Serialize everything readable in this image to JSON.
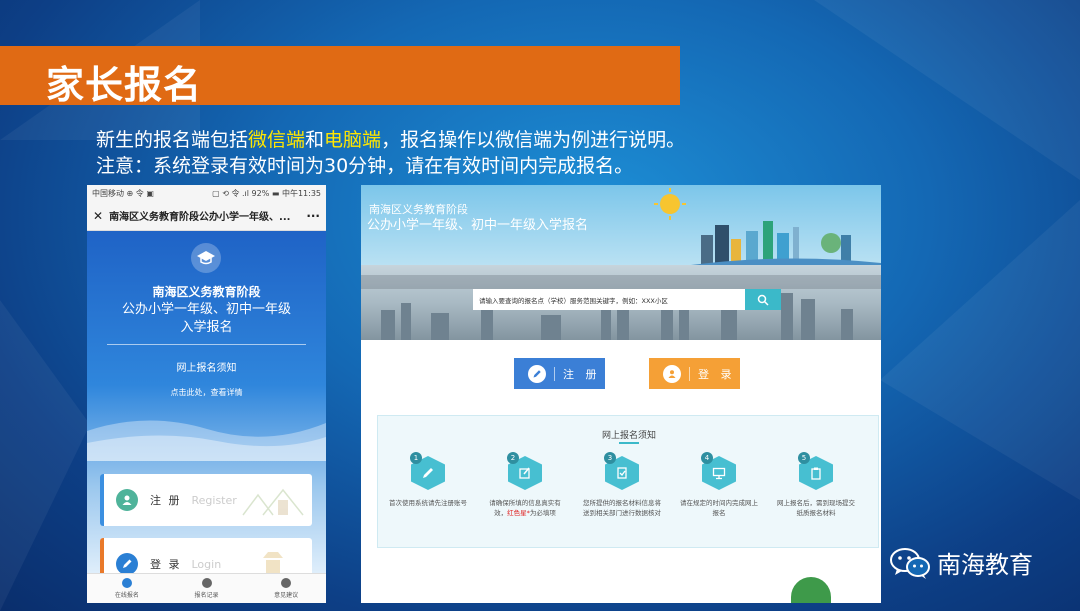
{
  "slide_title": "家长报名",
  "intro": {
    "line1_a": "新生的报名端包括",
    "line1_wechat": "微信端",
    "line1_and": "和",
    "line1_pc": "电脑端",
    "line1_b": "，报名操作以微信端为例进行说明。",
    "line2": "注意：系统登录有效时间为30分钟，请在有效时间内完成报名。"
  },
  "phone": {
    "status_left": "中国移动 ⊕ 令 ▣",
    "status_right": "▢ ⟲ 令 .ıl 92% ▬ 中午11:35",
    "close": "✕",
    "nav_title": "南海区义务教育阶段公办小学一年级、...",
    "more": "···",
    "title1": "南海区义务教育阶段",
    "title2": "公办小学一年级、初中一年级",
    "title3": "入学报名",
    "notice": "网上报名须知",
    "detail": "点击此处，查看详情",
    "register_label": "注 册",
    "register_en": "Register",
    "login_label": "登 录",
    "login_en": "Login",
    "tabs": [
      "在线报名",
      "报名记录",
      "意见建议"
    ]
  },
  "web": {
    "banner_line1": "南海区义务教育阶段",
    "banner_line2": "公办小学一年级、初中一年级入学报名",
    "search_placeholder": "请输入要查询的报名点（学校）服务范围关键字，例如：XXX小区",
    "register_btn": "注 册",
    "login_btn": "登 录",
    "notice_title": "网上报名须知",
    "steps": [
      {
        "num": "1",
        "text": "首次使用系统请先注册账号"
      },
      {
        "num": "2",
        "text_a": "请确保所填的信息真实有效，",
        "text_red": "红色星*",
        "text_b": "为必填项"
      },
      {
        "num": "3",
        "text": "您所提供的报名材料信息将送到相关部门进行数据核对"
      },
      {
        "num": "4",
        "text": "请在规定的时间内完成网上报名"
      },
      {
        "num": "5",
        "text": "网上报名后，需到现场提交纸质报名材料"
      }
    ]
  },
  "brand": "南海教育",
  "colors": {
    "orange": "#e06a14",
    "highlight": "#ffe600",
    "teal": "#47bfd1",
    "web_register": "#3b7fd6",
    "web_login": "#f5a036"
  }
}
